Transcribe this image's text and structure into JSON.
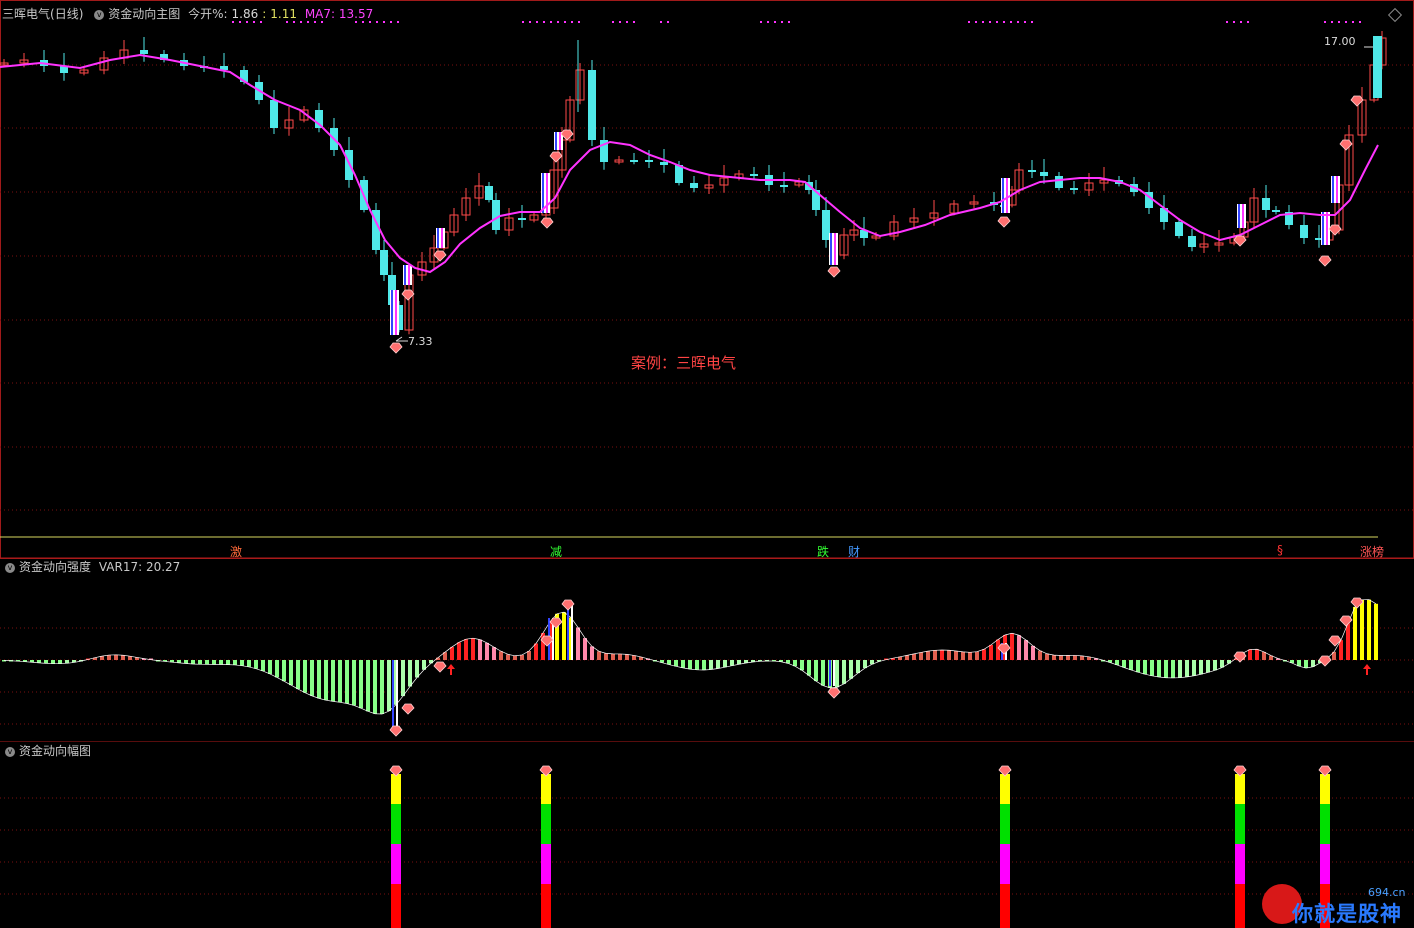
{
  "header": {
    "stock_name": "三晖电气",
    "period": "(日线)",
    "indicator_main": "资金动向主图",
    "label_open": "今开%:",
    "open_pct": "1.86",
    "sep": ":",
    "open_val": "1.11",
    "ma_label": "MA7: 13.57"
  },
  "main_chart": {
    "high_label": "17.00",
    "low_label": "7.33",
    "case_text": "案例：三晖电气",
    "colors": {
      "up": "#ff4a4a",
      "down": "#4fe8e8",
      "ma": "#ff33ff"
    }
  },
  "signals": {
    "items": [
      {
        "text": "激",
        "color": "#ff6a3a"
      },
      {
        "text": "减",
        "color": "#33ff33"
      },
      {
        "text": "跌",
        "color": "#33ff33"
      },
      {
        "text": "财",
        "color": "#4499ff"
      },
      {
        "text": "§",
        "color": "#ff3333"
      },
      {
        "text": "涨榜",
        "color": "#ff5555"
      }
    ]
  },
  "panel2": {
    "title": "资金动向强度",
    "var_label": "VAR17: 20.27"
  },
  "panel3": {
    "title": "资金动向幅图"
  },
  "watermark": {
    "site": "694.cn",
    "text": "你就是股神"
  }
}
